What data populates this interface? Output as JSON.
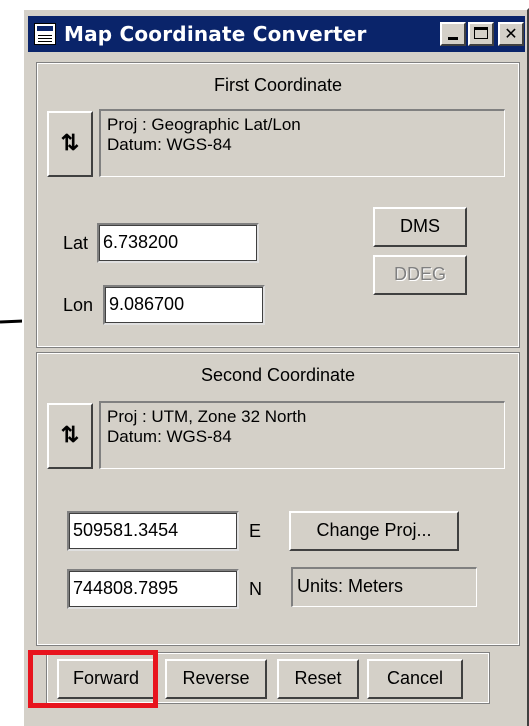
{
  "window": {
    "title": "Map Coordinate Converter"
  },
  "first": {
    "group_title": "First Coordinate",
    "proj": "Proj : Geographic Lat/Lon",
    "datum": "Datum: WGS-84",
    "lat_label": "Lat",
    "lat_value": "6.738200",
    "lon_label": "Lon",
    "lon_value": "9.086700",
    "dms_label": "DMS",
    "ddeg_label": "DDEG"
  },
  "second": {
    "group_title": "Second Coordinate",
    "proj": "Proj : UTM, Zone 32 North",
    "datum": "Datum: WGS-84",
    "easting_value": "509581.3454",
    "easting_label": "E",
    "northing_value": "744808.7895",
    "northing_label": "N",
    "change_proj_label": "Change Proj...",
    "units": "Units: Meters"
  },
  "footer": {
    "forward": "Forward",
    "reverse": "Reverse",
    "reset": "Reset",
    "cancel": "Cancel"
  },
  "icons": {
    "swap": "swap-arrows-icon",
    "app": "app-icon"
  },
  "colors": {
    "title_bar": "#0a246a",
    "highlight": "#e8141e",
    "face": "#d4d0c8"
  }
}
